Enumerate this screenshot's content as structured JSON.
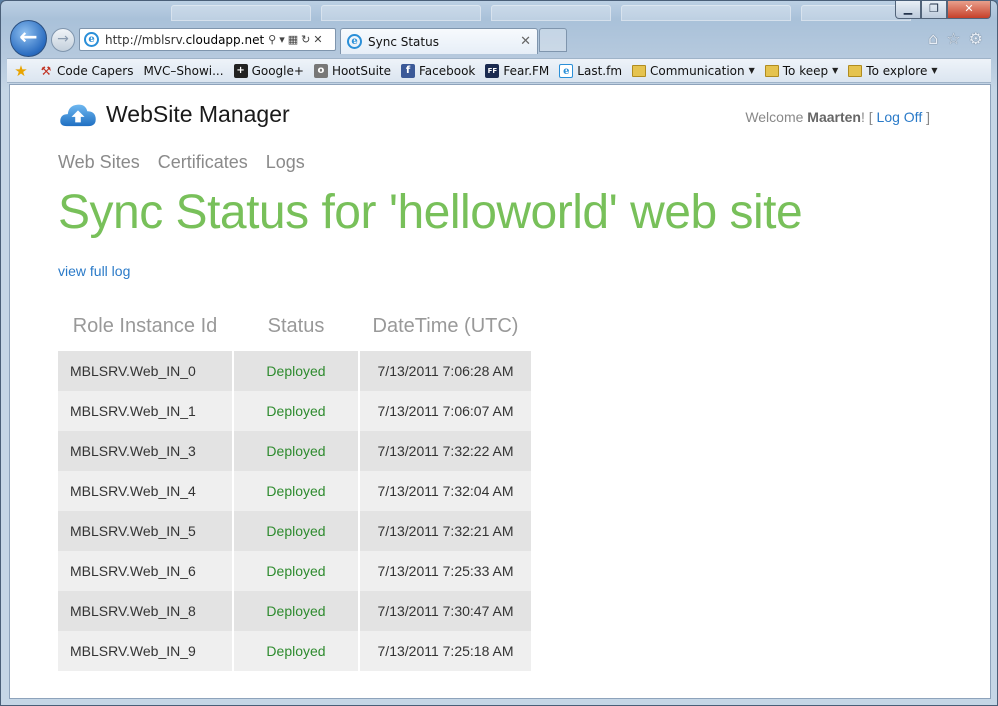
{
  "browser": {
    "url_prefix": "http://mblsrv.",
    "url_host": "cloudapp.net",
    "tab_title": "Sync Status",
    "favorites": [
      {
        "label": "Code Capers"
      },
      {
        "label": "MVC–Showi..."
      },
      {
        "label": "Google+"
      },
      {
        "label": "HootSuite"
      },
      {
        "label": "Facebook"
      },
      {
        "label": "Fear.FM"
      },
      {
        "label": "Last.fm"
      },
      {
        "label": "Communication"
      },
      {
        "label": "To keep"
      },
      {
        "label": "To explore"
      }
    ]
  },
  "site": {
    "logo_text": "WebSite Manager",
    "welcome": "Welcome",
    "user": "Maarten",
    "exclaim": "! [",
    "logoff": "Log Off",
    "close_bracket": "]",
    "menu": [
      "Web Sites",
      "Certificates",
      "Logs"
    ]
  },
  "page": {
    "title": "Sync Status for 'helloworld' web site",
    "full_log_link": "view full log"
  },
  "table": {
    "headers": [
      "Role Instance Id",
      "Status",
      "DateTime (UTC)"
    ],
    "rows": [
      [
        "MBLSRV.Web_IN_0",
        "Deployed",
        "7/13/2011 7:06:28 AM"
      ],
      [
        "MBLSRV.Web_IN_1",
        "Deployed",
        "7/13/2011 7:06:07 AM"
      ],
      [
        "MBLSRV.Web_IN_3",
        "Deployed",
        "7/13/2011 7:32:22 AM"
      ],
      [
        "MBLSRV.Web_IN_4",
        "Deployed",
        "7/13/2011 7:32:04 AM"
      ],
      [
        "MBLSRV.Web_IN_5",
        "Deployed",
        "7/13/2011 7:32:21 AM"
      ],
      [
        "MBLSRV.Web_IN_6",
        "Deployed",
        "7/13/2011 7:25:33 AM"
      ],
      [
        "MBLSRV.Web_IN_8",
        "Deployed",
        "7/13/2011 7:30:47 AM"
      ],
      [
        "MBLSRV.Web_IN_9",
        "Deployed",
        "7/13/2011 7:25:18 AM"
      ]
    ]
  },
  "colors": {
    "title_green": "#78c05a",
    "status_green": "#2e8b2e",
    "link_blue": "#2a7ac8"
  }
}
